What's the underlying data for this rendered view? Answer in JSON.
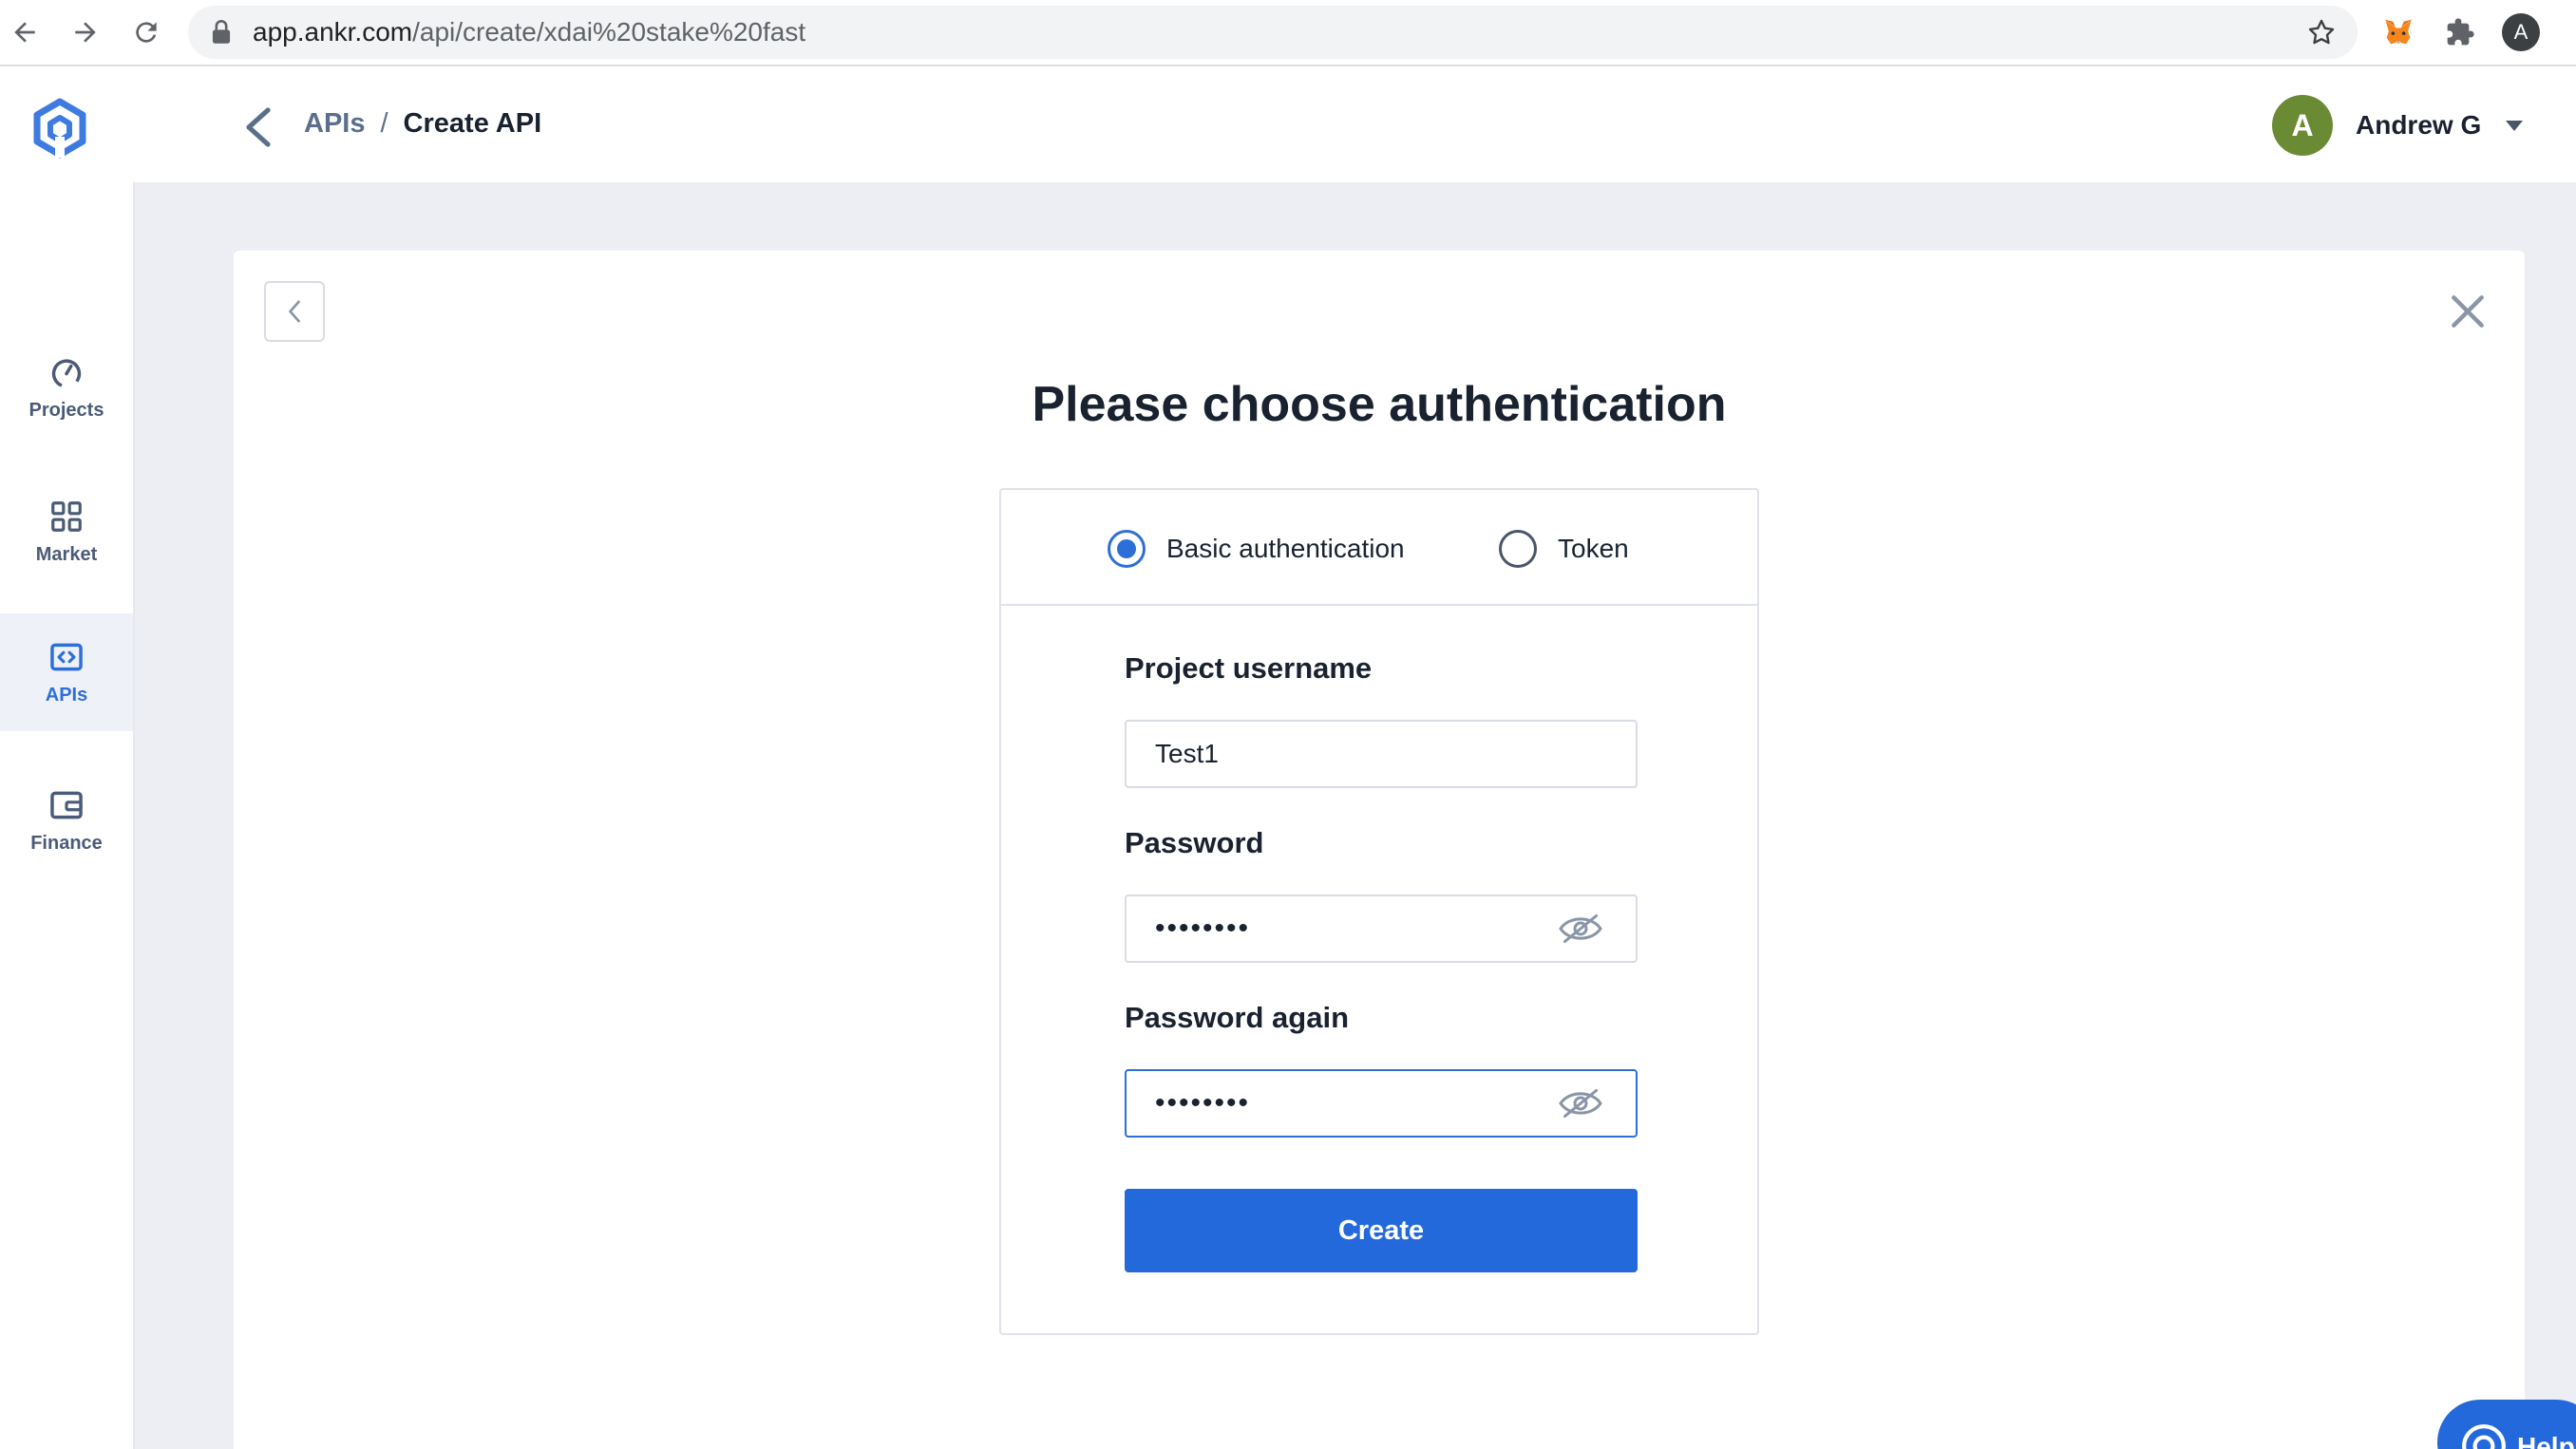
{
  "browser": {
    "url_host": "app.ankr.com",
    "url_path": "/api/create/xdai%20stake%20fast",
    "profile_initial": "A",
    "icons": [
      "back-arrow-icon",
      "forward-arrow-icon",
      "reload-icon",
      "lock-icon",
      "star-icon",
      "metamask-fox-icon",
      "puzzle-extensions-icon"
    ]
  },
  "header": {
    "breadcrumb_parent": "APIs",
    "breadcrumb_separator": "/",
    "breadcrumb_current": "Create API",
    "user_initial": "A",
    "user_name": "Andrew G"
  },
  "sidebar": {
    "items": [
      {
        "label": "Projects",
        "icon": "gauge-icon",
        "active": false
      },
      {
        "label": "Market",
        "icon": "grid-icon",
        "active": false
      },
      {
        "label": "APIs",
        "icon": "code-icon",
        "active": true
      },
      {
        "label": "Finance",
        "icon": "wallet-icon",
        "active": false
      }
    ]
  },
  "form": {
    "title": "Please choose authentication",
    "options": [
      {
        "label": "Basic authentication",
        "checked": true
      },
      {
        "label": "Token",
        "checked": false
      }
    ],
    "username_label": "Project username",
    "username_value": "Test1",
    "password_label": "Password",
    "password_value": "••••••••",
    "password_again_label": "Password again",
    "password_again_value": "••••••••",
    "submit_label": "Create"
  },
  "help": {
    "label": "Help"
  },
  "colors": {
    "accent": "#2469db",
    "avatar": "#6a8a34",
    "background": "#eceef3"
  }
}
